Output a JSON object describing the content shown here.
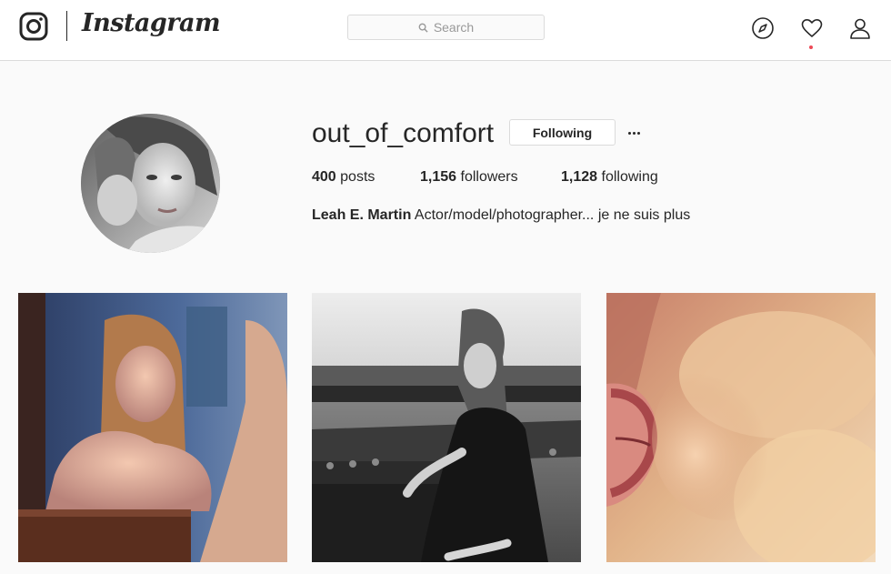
{
  "nav": {
    "logo_icon": "instagram-glyph-icon",
    "wordmark": "Instagram",
    "search": {
      "icon": "search-icon",
      "placeholder": "Search"
    },
    "icons": [
      "compass-icon",
      "heart-icon",
      "person-icon"
    ],
    "notification_dot_color": "#ed4956"
  },
  "profile": {
    "username": "out_of_comfort",
    "follow_button_label": "Following",
    "more_icon": "ellipsis-icon",
    "stats": {
      "posts_count": "400",
      "posts_label": "posts",
      "followers_count": "1,156",
      "followers_label": "followers",
      "following_count": "1,128",
      "following_label": "following"
    },
    "full_name": "Leah E. Martin",
    "bio": "Actor/model/photographer... je ne suis plus"
  },
  "posts": [
    {
      "description": ""
    },
    {
      "description": ""
    },
    {
      "description": ""
    }
  ],
  "colors": {
    "background": "#fafafa",
    "border": "#dbdbdb",
    "text": "#262626",
    "placeholder": "#999999"
  }
}
